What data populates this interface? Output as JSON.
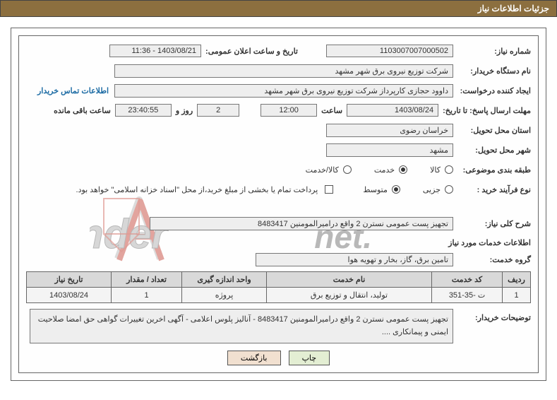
{
  "header": {
    "title": "جزئیات اطلاعات نیاز"
  },
  "labels": {
    "need_no": "شماره نیاز:",
    "date_time": "تاریخ و ساعت اعلان عمومی:",
    "buyer_org": "نام دستگاه خریدار:",
    "requester": "ایجاد کننده درخواست:",
    "buyer_contact": "اطلاعات تماس خریدار",
    "reply_deadline": "مهلت ارسال پاسخ: تا تاریخ:",
    "hour": "ساعت",
    "days_and": "روز و",
    "remaining": "ساعت باقی مانده",
    "delivery_province": "استان محل تحویل:",
    "delivery_city": "شهر محل تحویل:",
    "category": "طبقه بندی موضوعی:",
    "cat_goods": "کالا",
    "cat_service": "خدمت",
    "cat_goods_service": "کالا/خدمت",
    "buy_type": "نوع فرآیند خرید :",
    "buy_partial": "جزیی",
    "buy_medium": "متوسط",
    "treasury_note": "پرداخت تمام یا بخشی از مبلغ خرید،از محل \"اسناد خزانه اسلامی\" خواهد بود.",
    "need_desc": "شرح کلی نیاز:",
    "services_info": "اطلاعات خدمات مورد نیاز",
    "service_group": "گروه خدمت:",
    "buyer_notes": "توضیحات خریدار:"
  },
  "fields": {
    "need_no": "1103007007000502",
    "date_time": "1403/08/21 - 11:36",
    "buyer_org": "شرکت توزیع نیروی برق شهر مشهد",
    "requester": "داوود حجازی کارپرداز شرکت توزیع نیروی برق شهر مشهد",
    "deadline_date": "1403/08/24",
    "deadline_time": "12:00",
    "days_left": "2",
    "time_left": "23:40:55",
    "province": "خراسان رضوی",
    "city": "مشهد",
    "need_desc": "تجهیز پست عمومی نسترن 2  واقع درامیرالمومنین   8483417",
    "service_group": "تامین برق، گاز، بخار و تهویه هوا",
    "buyer_notes": "تجهیز پست عمومی نسترن 2  واقع درامیرالمومنین   8483417  - آنالیز پلوس اعلامی - آگهی اخرین تغییرات گواهی حق امضا صلاحیت ایمنی و پیمانکاری ...."
  },
  "table": {
    "headers": {
      "row": "ردیف",
      "code": "کد خدمت",
      "name": "نام خدمت",
      "unit": "واحد اندازه گیری",
      "qty": "تعداد / مقدار",
      "date": "تاریخ نیاز"
    },
    "rows": [
      {
        "row": "1",
        "code": "ت -35-351",
        "name": "تولید، انتقال و توزیع برق",
        "unit": "پروژه",
        "qty": "1",
        "date": "1403/08/24"
      }
    ]
  },
  "buttons": {
    "print": "چاپ",
    "back": "بازگشت"
  },
  "watermark": {
    "text": "AriaTender.net"
  }
}
